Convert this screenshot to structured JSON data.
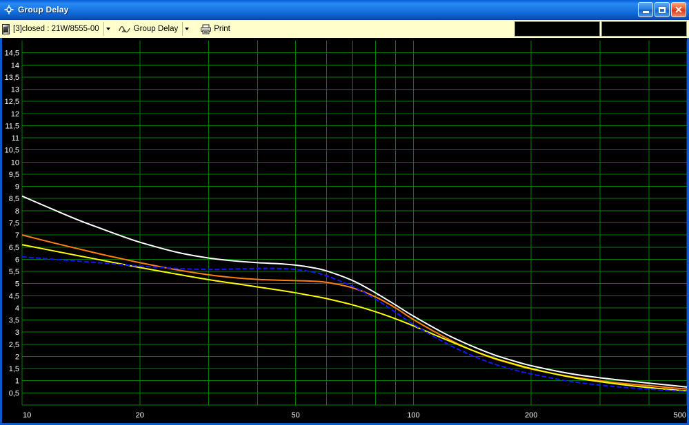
{
  "window": {
    "title": "Group Delay",
    "title_icon": "crosshair-icon",
    "controls": {
      "minimize_label": "_",
      "maximize_label": "□",
      "close_label": "✕"
    }
  },
  "toolbar": {
    "driver_icon": "driver-icon",
    "driver_select_value": "[3]closed : 21W/8555-00",
    "measure_icon": "curve-icon",
    "measure_select_value": "Group Delay",
    "print_icon": "printer-icon",
    "print_label": "Print",
    "panels": [
      "",
      ""
    ]
  },
  "colors": {
    "background": "#000000",
    "grid": "#008000",
    "axis_text": "#ffffff",
    "title_bar": "#1271e8",
    "toolbar_bg": "#ffffcc",
    "frame": "#1159c9",
    "series_white": "#ffffff",
    "series_orange": "#ff7f11",
    "series_yellow": "#ffff00",
    "series_blue": "#1414ff"
  },
  "chart_data": {
    "type": "line",
    "title": "Group Delay",
    "xlabel": "",
    "ylabel": "",
    "xscale": "log",
    "yscale": "linear",
    "xlim": [
      10,
      500
    ],
    "ylim": [
      0,
      15
    ],
    "grid": true,
    "legend": "none",
    "x_ticks": [
      10,
      20,
      50,
      100,
      200,
      500
    ],
    "x_tick_labels": [
      "10",
      "20",
      "50",
      "100",
      "200",
      "500"
    ],
    "x_gridlines": [
      10,
      20,
      30,
      40,
      50,
      60,
      70,
      80,
      90,
      100,
      200,
      300,
      400,
      500
    ],
    "y_ticks": [
      0.5,
      1,
      1.5,
      2,
      2.5,
      3,
      3.5,
      4,
      4.5,
      5,
      5.5,
      6,
      6.5,
      7,
      7.5,
      8,
      8.5,
      9,
      9.5,
      10,
      10.5,
      11,
      11.5,
      12,
      12.5,
      13,
      13.5,
      14,
      14.5
    ],
    "y_tick_labels": [
      "0,5",
      "1",
      "1,5",
      "2",
      "2,5",
      "3",
      "3,5",
      "4",
      "4,5",
      "5",
      "5,5",
      "6",
      "6,5",
      "7",
      "7,5",
      "8",
      "8,5",
      "9",
      "9,5",
      "10",
      "10,5",
      "11",
      "11,5",
      "12",
      "12,5",
      "13",
      "13,5",
      "14",
      "14,5"
    ],
    "x": [
      10,
      12,
      14,
      16,
      18,
      20,
      25,
      30,
      35,
      40,
      45,
      50,
      55,
      60,
      70,
      80,
      90,
      100,
      120,
      140,
      160,
      180,
      200,
      250,
      300,
      350,
      400,
      450,
      500
    ],
    "series": [
      {
        "name": "white",
        "color": "#ffffff",
        "style": "solid",
        "values": [
          8.6,
          8.05,
          7.6,
          7.25,
          6.95,
          6.7,
          6.28,
          6.05,
          5.93,
          5.86,
          5.82,
          5.76,
          5.66,
          5.52,
          5.12,
          4.62,
          4.12,
          3.66,
          2.95,
          2.45,
          2.08,
          1.82,
          1.62,
          1.3,
          1.12,
          1.0,
          0.9,
          0.82,
          0.74
        ]
      },
      {
        "name": "orange",
        "color": "#ff7f11",
        "style": "solid",
        "values": [
          7.0,
          6.68,
          6.42,
          6.2,
          6.02,
          5.86,
          5.56,
          5.36,
          5.24,
          5.17,
          5.14,
          5.12,
          5.1,
          5.05,
          4.82,
          4.45,
          4.0,
          3.52,
          2.8,
          2.28,
          1.92,
          1.68,
          1.48,
          1.18,
          1.0,
          0.88,
          0.8,
          0.72,
          0.66
        ]
      },
      {
        "name": "yellow",
        "color": "#ffff00",
        "style": "solid",
        "values": [
          6.6,
          6.35,
          6.14,
          5.96,
          5.8,
          5.66,
          5.38,
          5.16,
          5.0,
          4.86,
          4.74,
          4.62,
          4.5,
          4.38,
          4.12,
          3.84,
          3.55,
          3.26,
          2.72,
          2.28,
          1.94,
          1.7,
          1.5,
          1.16,
          0.96,
          0.82,
          0.72,
          0.64,
          0.58
        ]
      },
      {
        "name": "blue",
        "color": "#1414ff",
        "style": "dashed",
        "values": [
          6.1,
          6.0,
          5.92,
          5.85,
          5.78,
          5.72,
          5.62,
          5.58,
          5.6,
          5.62,
          5.62,
          5.58,
          5.48,
          5.32,
          4.88,
          4.36,
          3.82,
          3.32,
          2.58,
          2.06,
          1.7,
          1.46,
          1.28,
          0.98,
          0.82,
          0.72,
          0.66,
          0.6,
          0.56
        ]
      }
    ]
  }
}
